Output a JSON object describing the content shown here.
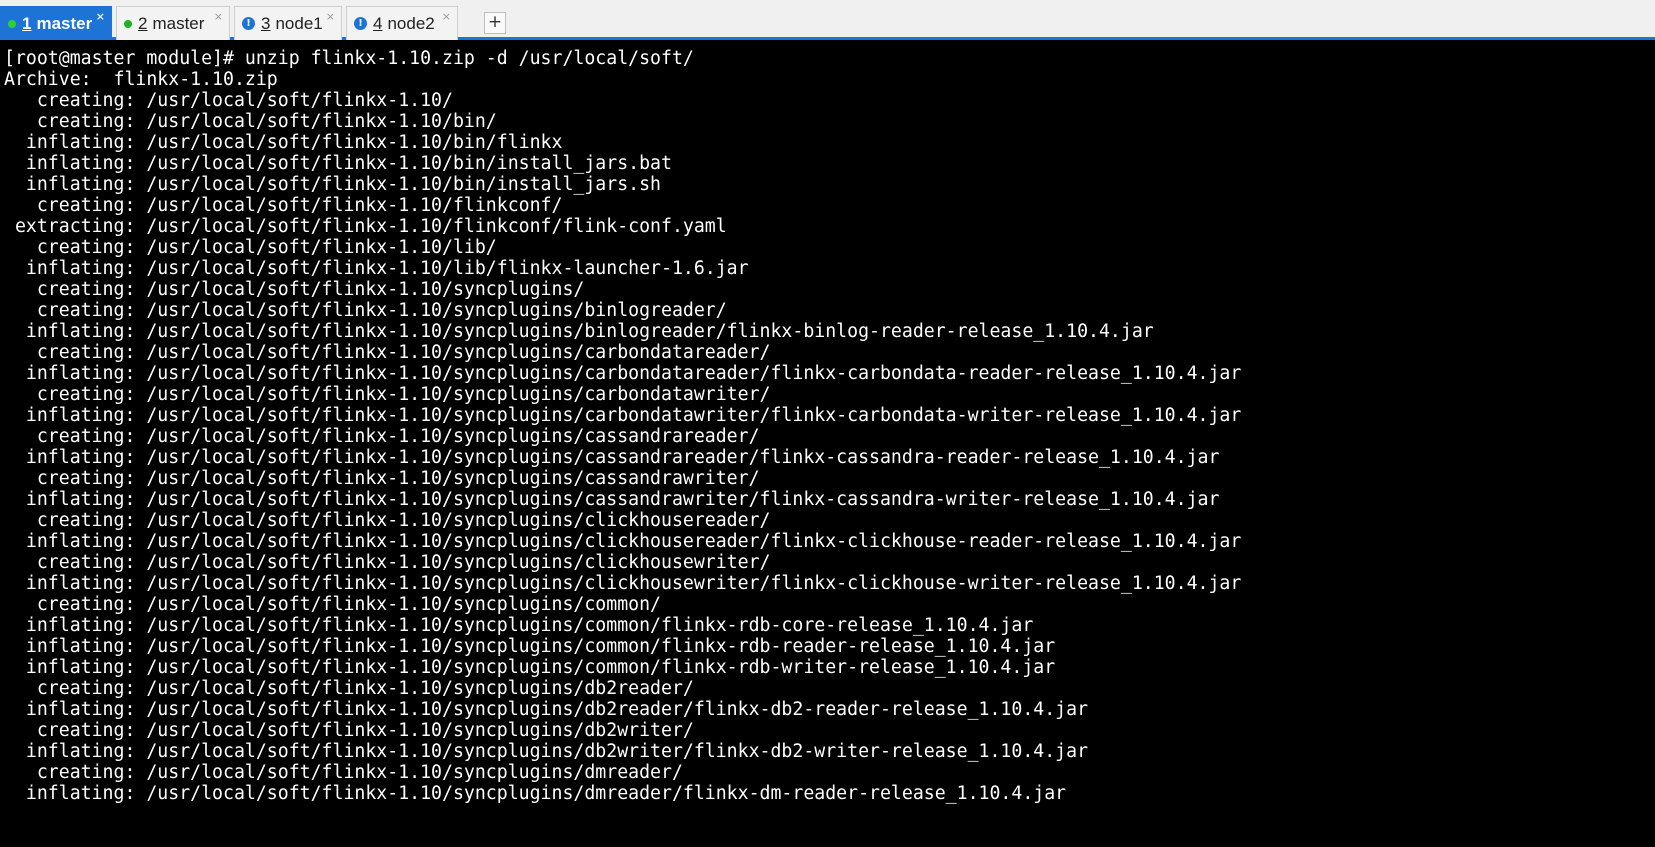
{
  "tabs": [
    {
      "number": "1",
      "label": "master",
      "status": "connected",
      "status_icon": "green-dot-icon",
      "active": true,
      "close_label": "×"
    },
    {
      "number": "2",
      "label": "master",
      "status": "connected",
      "status_icon": "green-dot-icon",
      "active": false,
      "close_label": "×"
    },
    {
      "number": "3",
      "label": "node1",
      "status": "warning",
      "status_icon": "info-badge-icon",
      "status_text": "!",
      "active": false,
      "close_label": "×"
    },
    {
      "number": "4",
      "label": "node2",
      "status": "warning",
      "status_icon": "info-badge-icon",
      "status_text": "!",
      "active": false,
      "close_label": "×"
    }
  ],
  "new_tab_label": "+",
  "colors": {
    "accent": "#1e73d6",
    "connected": "#1fb21f",
    "terminal_bg": "#000000",
    "terminal_fg": "#ffffff"
  },
  "terminal": {
    "lines": [
      "[root@master module]# unzip flinkx-1.10.zip -d /usr/local/soft/",
      "Archive:  flinkx-1.10.zip",
      "   creating: /usr/local/soft/flinkx-1.10/",
      "   creating: /usr/local/soft/flinkx-1.10/bin/",
      "  inflating: /usr/local/soft/flinkx-1.10/bin/flinkx",
      "  inflating: /usr/local/soft/flinkx-1.10/bin/install_jars.bat",
      "  inflating: /usr/local/soft/flinkx-1.10/bin/install_jars.sh",
      "   creating: /usr/local/soft/flinkx-1.10/flinkconf/",
      " extracting: /usr/local/soft/flinkx-1.10/flinkconf/flink-conf.yaml",
      "   creating: /usr/local/soft/flinkx-1.10/lib/",
      "  inflating: /usr/local/soft/flinkx-1.10/lib/flinkx-launcher-1.6.jar",
      "   creating: /usr/local/soft/flinkx-1.10/syncplugins/",
      "   creating: /usr/local/soft/flinkx-1.10/syncplugins/binlogreader/",
      "  inflating: /usr/local/soft/flinkx-1.10/syncplugins/binlogreader/flinkx-binlog-reader-release_1.10.4.jar",
      "   creating: /usr/local/soft/flinkx-1.10/syncplugins/carbondatareader/",
      "  inflating: /usr/local/soft/flinkx-1.10/syncplugins/carbondatareader/flinkx-carbondata-reader-release_1.10.4.jar",
      "   creating: /usr/local/soft/flinkx-1.10/syncplugins/carbondatawriter/",
      "  inflating: /usr/local/soft/flinkx-1.10/syncplugins/carbondatawriter/flinkx-carbondata-writer-release_1.10.4.jar",
      "   creating: /usr/local/soft/flinkx-1.10/syncplugins/cassandrareader/",
      "  inflating: /usr/local/soft/flinkx-1.10/syncplugins/cassandrareader/flinkx-cassandra-reader-release_1.10.4.jar",
      "   creating: /usr/local/soft/flinkx-1.10/syncplugins/cassandrawriter/",
      "  inflating: /usr/local/soft/flinkx-1.10/syncplugins/cassandrawriter/flinkx-cassandra-writer-release_1.10.4.jar",
      "   creating: /usr/local/soft/flinkx-1.10/syncplugins/clickhousereader/",
      "  inflating: /usr/local/soft/flinkx-1.10/syncplugins/clickhousereader/flinkx-clickhouse-reader-release_1.10.4.jar",
      "   creating: /usr/local/soft/flinkx-1.10/syncplugins/clickhousewriter/",
      "  inflating: /usr/local/soft/flinkx-1.10/syncplugins/clickhousewriter/flinkx-clickhouse-writer-release_1.10.4.jar",
      "   creating: /usr/local/soft/flinkx-1.10/syncplugins/common/",
      "  inflating: /usr/local/soft/flinkx-1.10/syncplugins/common/flinkx-rdb-core-release_1.10.4.jar",
      "  inflating: /usr/local/soft/flinkx-1.10/syncplugins/common/flinkx-rdb-reader-release_1.10.4.jar",
      "  inflating: /usr/local/soft/flinkx-1.10/syncplugins/common/flinkx-rdb-writer-release_1.10.4.jar",
      "   creating: /usr/local/soft/flinkx-1.10/syncplugins/db2reader/",
      "  inflating: /usr/local/soft/flinkx-1.10/syncplugins/db2reader/flinkx-db2-reader-release_1.10.4.jar",
      "   creating: /usr/local/soft/flinkx-1.10/syncplugins/db2writer/",
      "  inflating: /usr/local/soft/flinkx-1.10/syncplugins/db2writer/flinkx-db2-writer-release_1.10.4.jar",
      "   creating: /usr/local/soft/flinkx-1.10/syncplugins/dmreader/",
      "  inflating: /usr/local/soft/flinkx-1.10/syncplugins/dmreader/flinkx-dm-reader-release_1.10.4.jar"
    ]
  }
}
